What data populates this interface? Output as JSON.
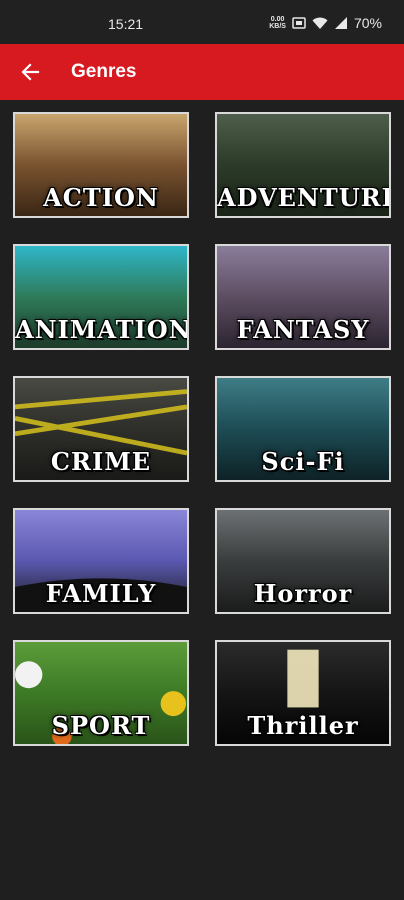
{
  "status_bar": {
    "time": "15:21",
    "speed_value": "0.00",
    "speed_unit": "KB/S",
    "battery": "70%"
  },
  "app_bar": {
    "title": "Genres"
  },
  "genres": [
    {
      "label": "ACTION",
      "bg": [
        "#c9a56e",
        "#7a5330",
        "#3a2614"
      ]
    },
    {
      "label": "ADVENTURE",
      "bg": [
        "#4e5e4a",
        "#2c3b29",
        "#1b2418"
      ]
    },
    {
      "label": "ANIMATION",
      "bg": [
        "#2fb6c8",
        "#2e7b5a",
        "#1d3b2a"
      ]
    },
    {
      "label": "FANTASY",
      "bg": [
        "#8a7d9a",
        "#5d4e63",
        "#2c2430"
      ]
    },
    {
      "label": "CRIME",
      "bg": [
        "#4a4a44",
        "#2e2e2a",
        "#1a1a18"
      ]
    },
    {
      "label": "Sci-Fi",
      "bg": [
        "#3f7d86",
        "#1d4c55",
        "#0e2226"
      ]
    },
    {
      "label": "FAMILY",
      "bg": [
        "#8a86d8",
        "#5a58b0",
        "#1a1a1a"
      ]
    },
    {
      "label": "Horror",
      "bg": [
        "#6c7173",
        "#3a3d3e",
        "#1b1c1c"
      ]
    },
    {
      "label": "SPORT",
      "bg": [
        "#5d9c3a",
        "#3d7a26",
        "#2a5419"
      ]
    },
    {
      "label": "Thriller",
      "bg": [
        "#2b2b2b",
        "#151515",
        "#050505"
      ]
    }
  ]
}
